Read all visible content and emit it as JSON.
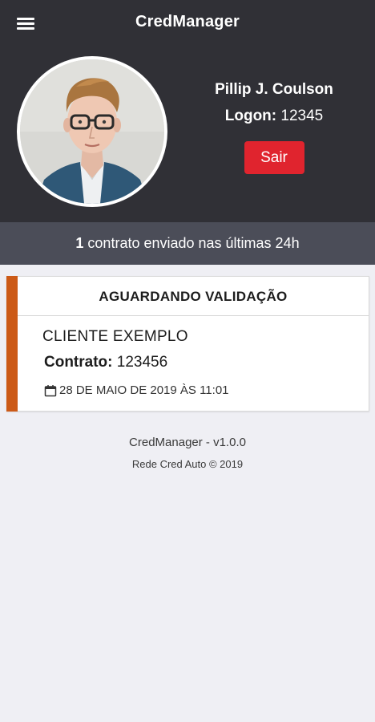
{
  "header": {
    "title": "CredManager",
    "menu_icon": "hamburger-menu-icon"
  },
  "profile": {
    "name": "Pillip J. Coulson",
    "logon_label": "Logon:",
    "logon_value": "12345",
    "logout_label": "Sair"
  },
  "summary": {
    "count": "1",
    "text": "contrato enviado nas últimas 24h"
  },
  "card": {
    "status": "AGUARDANDO VALIDAÇÃO",
    "client": "CLIENTE EXEMPLO",
    "contract_label": "Contrato:",
    "contract_value": "123456",
    "date": "28 DE MAIO DE 2019 ÀS 11:01",
    "accent_color": "#cc5a17"
  },
  "footer": {
    "version": "CredManager - v1.0.0",
    "copyright": "Rede Cred Auto © 2019"
  },
  "colors": {
    "header_bg": "#303036",
    "summary_bg": "#4b4d58",
    "logout_bg": "#e0242e",
    "page_bg": "#efeff4"
  }
}
